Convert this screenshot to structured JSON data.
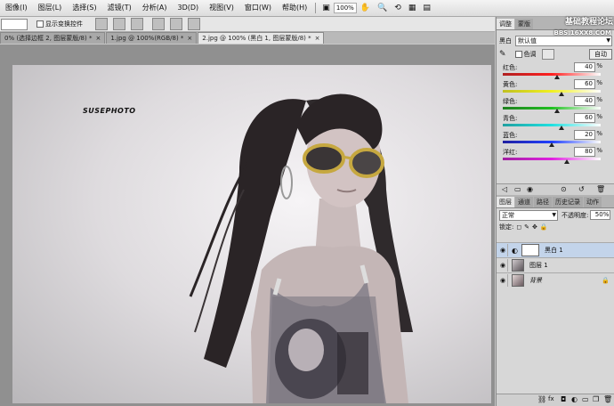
{
  "menubar": {
    "items": [
      "图像(I)",
      "图层(L)",
      "选择(S)",
      "滤镜(T)",
      "分析(A)",
      "3D(D)",
      "视图(V)",
      "窗口(W)",
      "帮助(H)"
    ],
    "zoom": "100%"
  },
  "options": {
    "show_transform_controls": "显示变换控件"
  },
  "tabs": [
    {
      "label": "0% (选择边框 2, 图层蒙版/8) *",
      "active": false
    },
    {
      "label": "1.jpg @ 100%(RGB/8) *",
      "active": false
    },
    {
      "label": "2.jpg @ 100% (黑白 1, 图层蒙版/8) *",
      "active": true
    }
  ],
  "canvas": {
    "watermark": "SUSEPHOTO"
  },
  "adjust_panel": {
    "tabs": [
      "调整",
      "蒙版"
    ],
    "forum": "基础教程论坛",
    "forum_url": "BBS.16XX8.COM",
    "preset_label": "黑白",
    "preset_value": "默认值",
    "tint_label": "色调",
    "auto_label": "自动",
    "sliders": [
      {
        "label": "红色:",
        "value": "40",
        "level": 0.55,
        "c1": "#ff2020",
        "c2": "#b02020"
      },
      {
        "label": "黄色:",
        "value": "60",
        "level": 0.6,
        "c1": "#f0f020",
        "c2": "#c0c020"
      },
      {
        "label": "绿色:",
        "value": "40",
        "level": 0.55,
        "c1": "#20c020",
        "c2": "#208020"
      },
      {
        "label": "青色:",
        "value": "60",
        "level": 0.6,
        "c1": "#20e0e0",
        "c2": "#20a0a0"
      },
      {
        "label": "蓝色:",
        "value": "20",
        "level": 0.5,
        "c1": "#2040ff",
        "c2": "#2020a0"
      },
      {
        "label": "洋红:",
        "value": "80",
        "level": 0.65,
        "c1": "#e020e0",
        "c2": "#a020a0"
      }
    ]
  },
  "layers_panel": {
    "tabs": [
      "图层",
      "通道",
      "路径",
      "历史记录",
      "动作"
    ],
    "blend_mode": "正常",
    "opacity_label": "不透明度:",
    "opacity_value": "50%",
    "lock_label": "锁定:",
    "layers": [
      {
        "name": "黑白 1",
        "selected": true
      },
      {
        "name": "图层 1",
        "selected": false
      },
      {
        "name": "背景",
        "selected": false
      }
    ]
  }
}
